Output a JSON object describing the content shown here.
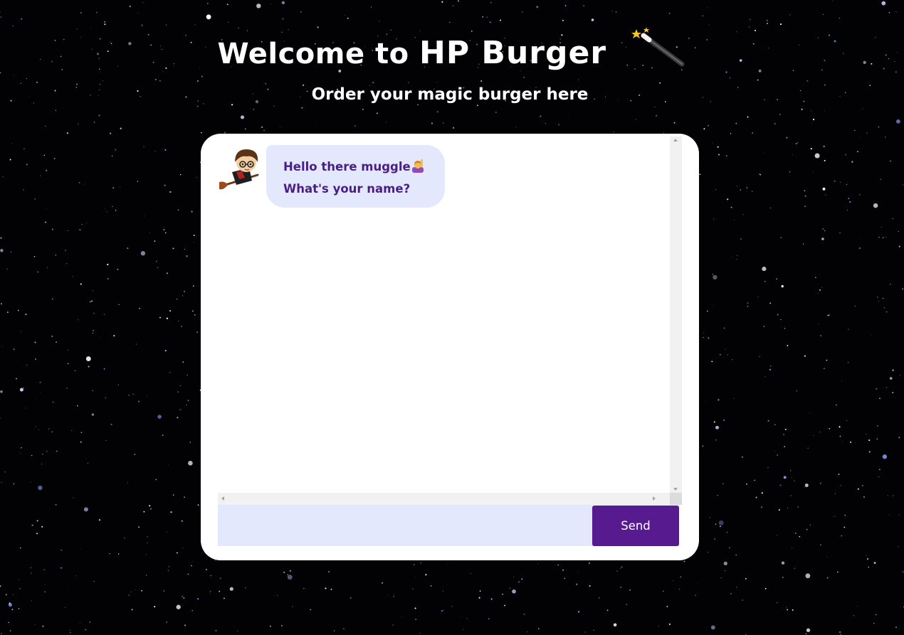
{
  "header": {
    "title_prefix": "Welcome to ",
    "title_brand": "HP Burger",
    "title_icon": "magic-wand-icon",
    "subtitle": "Order your magic burger here"
  },
  "chat": {
    "messages": [
      {
        "sender": "bot",
        "avatar_icon": "harry-potter-broom-avatar",
        "line1": "Hello there muggle",
        "line1_icon": "person-raising-hand-icon",
        "line2": "What's your name?"
      }
    ]
  },
  "composer": {
    "input_value": "",
    "input_placeholder": "",
    "send_label": "Send"
  },
  "colors": {
    "background": "#020205",
    "card": "#ffffff",
    "bubble": "#e4e8fd",
    "bubble_text": "#4b1d86",
    "input_bar": "#e4e8fd",
    "send_button": "#571b8f",
    "send_text": "#ffffff"
  }
}
